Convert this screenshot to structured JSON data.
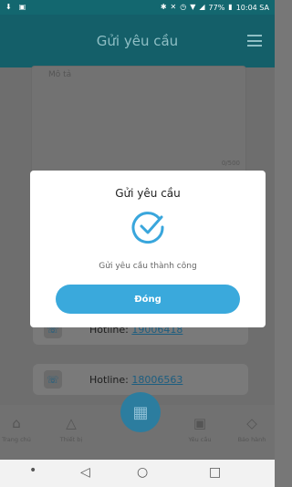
{
  "status_bar": {
    "battery": "77%",
    "time": "10:04 SA",
    "left_icons": [
      "download-icon",
      "image-icon"
    ],
    "right_icons": [
      "bluetooth-icon",
      "mute-icon",
      "alarm-icon",
      "wifi-icon",
      "signal-icon",
      "battery-icon"
    ]
  },
  "header": {
    "title": "Gửi yêu cầu"
  },
  "form": {
    "description_label": "Mô tả",
    "char_count": "0/500"
  },
  "hotlines": [
    {
      "label": "Hotline:",
      "number": "19006418"
    },
    {
      "label": "Hotline:",
      "number": "18006563"
    }
  ],
  "bottom_nav": {
    "items": [
      {
        "label": "Trang chủ",
        "icon": "home-icon"
      },
      {
        "label": "Thiết bị",
        "icon": "device-icon"
      },
      {
        "label": "Yêu cầu",
        "icon": "request-icon"
      },
      {
        "label": "Bảo hành",
        "icon": "warranty-icon"
      }
    ],
    "center_icon": "qr-scan-icon"
  },
  "modal": {
    "title": "Gửi yêu cầu",
    "message": "Gửi yêu cầu thành công",
    "button_label": "Đóng",
    "icon": "check-circle-icon"
  },
  "colors": {
    "header_bg": "#145f69",
    "accent_button": "#3aa9dc",
    "check_color": "#39a6dc"
  }
}
